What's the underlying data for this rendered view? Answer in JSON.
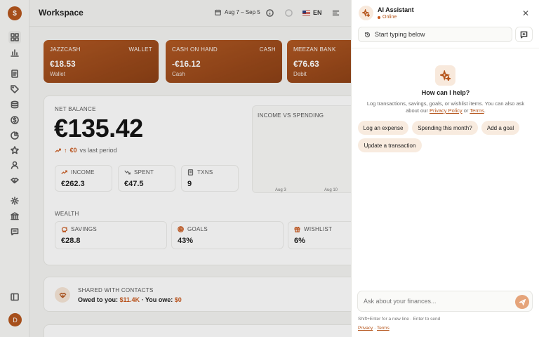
{
  "sidebar": {
    "logo_letter": "$",
    "icons": [
      "dashboard-icon",
      "bar-chart-icon",
      "document-icon",
      "tag-icon",
      "database-icon",
      "dollar-icon",
      "pie-chart-icon",
      "star-icon",
      "user-icon",
      "handshake-icon",
      "settings-icon",
      "bank-icon",
      "chat-icon",
      "panel-icon"
    ],
    "avatar_letter": "D"
  },
  "header": {
    "title": "Workspace",
    "date_range": "Aug 7 – Sep 5",
    "lang": "EN"
  },
  "accounts": [
    {
      "name": "JAZZCASH",
      "type": "WALLET",
      "amount": "€18.53",
      "sub": "Wallet"
    },
    {
      "name": "CASH ON HAND",
      "type": "CASH",
      "amount": "-€16.12",
      "sub": "Cash"
    },
    {
      "name": "MEEZAN BANK",
      "type": "",
      "amount": "€76.63",
      "sub": "Debit"
    }
  ],
  "net_balance": {
    "label": "NET BALANCE",
    "amount": "€135.42",
    "change_value": "€0",
    "change_text": "vs last period"
  },
  "stats": [
    {
      "label": "INCOME",
      "value": "€262.3",
      "icon": "trend-up-icon"
    },
    {
      "label": "SPENT",
      "value": "€47.5",
      "icon": "trend-down-icon"
    },
    {
      "label": "TXNS",
      "value": "9",
      "icon": "receipt-icon"
    }
  ],
  "chart": {
    "title": "INCOME VS SPENDING",
    "x_labels": [
      "Aug 3",
      "Aug 10"
    ]
  },
  "wealth": {
    "label": "WEALTH",
    "items": [
      {
        "label": "SAVINGS",
        "value": "€28.8",
        "icon": "piggy-bank-icon"
      },
      {
        "label": "GOALS",
        "value": "43%",
        "icon": "target-icon"
      },
      {
        "label": "WISHLIST",
        "value": "6%",
        "icon": "gift-icon"
      }
    ]
  },
  "shared": {
    "label": "SHARED WITH CONTACTS",
    "owed_prefix": "Owed to you:",
    "owed_value": "$11.4K",
    "sep": "·",
    "owe_prefix": "You owe:",
    "owe_value": "$0"
  },
  "ai": {
    "title": "AI Assistant",
    "status": "Online",
    "thread": "Start typing below",
    "help_title": "How can I help?",
    "help_desc_1": "Log transactions, savings, goals, or wishlist items. You can also ask about our",
    "privacy": "Privacy Policy",
    "or": "or",
    "terms": "Terms",
    "period": ".",
    "chips": [
      "Log an expense",
      "Spending this month?",
      "Add a goal",
      "Update a transaction"
    ],
    "input_placeholder": "Ask about your finances...",
    "hint": "Shift+Enter for a new line · Enter to send",
    "footer_privacy": "Privacy",
    "footer_sep": "·",
    "footer_terms": "Terms"
  },
  "colors": {
    "accent": "#b5541a",
    "card": "#9a4716",
    "chip": "#f8ebdf"
  }
}
